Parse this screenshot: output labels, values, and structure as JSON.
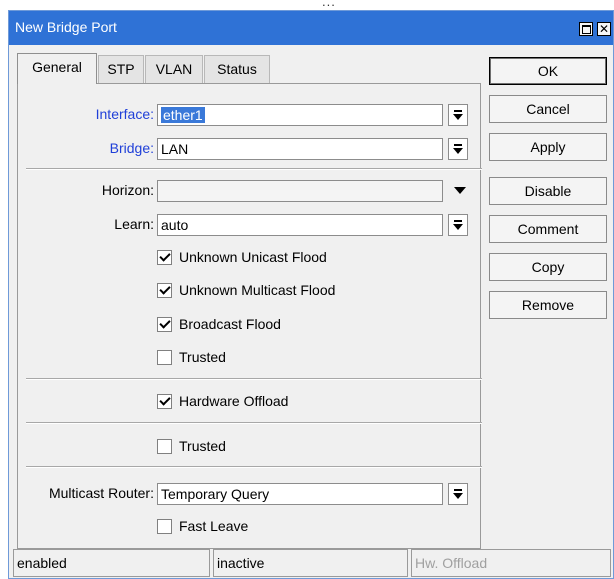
{
  "background": {
    "text": "..."
  },
  "window": {
    "title": "New Bridge Port",
    "tabs": [
      {
        "label": "General",
        "active": true
      },
      {
        "label": "STP",
        "active": false
      },
      {
        "label": "VLAN",
        "active": false
      },
      {
        "label": "Status",
        "active": false
      }
    ],
    "fields": {
      "interface": {
        "label": "Interface:",
        "value": "ether1"
      },
      "bridge": {
        "label": "Bridge:",
        "value": "LAN"
      },
      "horizon": {
        "label": "Horizon:",
        "value": ""
      },
      "learn": {
        "label": "Learn:",
        "value": "auto"
      },
      "multicast_router": {
        "label": "Multicast Router:",
        "value": "Temporary Query"
      }
    },
    "checkboxes": {
      "unknown_unicast_flood": {
        "label": "Unknown Unicast Flood",
        "checked": true
      },
      "unknown_multicast_flood": {
        "label": "Unknown Multicast Flood",
        "checked": true
      },
      "broadcast_flood": {
        "label": "Broadcast Flood",
        "checked": true
      },
      "trusted_1": {
        "label": "Trusted",
        "checked": false
      },
      "hardware_offload": {
        "label": "Hardware Offload",
        "checked": true
      },
      "trusted_2": {
        "label": "Trusted",
        "checked": false
      },
      "fast_leave": {
        "label": "Fast Leave",
        "checked": false
      }
    },
    "buttons": {
      "ok": "OK",
      "cancel": "Cancel",
      "apply": "Apply",
      "disable": "Disable",
      "comment": "Comment",
      "copy": "Copy",
      "remove": "Remove"
    },
    "status": {
      "enabled": "enabled",
      "state": "inactive",
      "hw_offload": "Hw. Offload"
    }
  },
  "colors": {
    "titlebar": "#2f72d6",
    "label_blue": "#1f3fd8",
    "selection": "#3a79d9"
  }
}
